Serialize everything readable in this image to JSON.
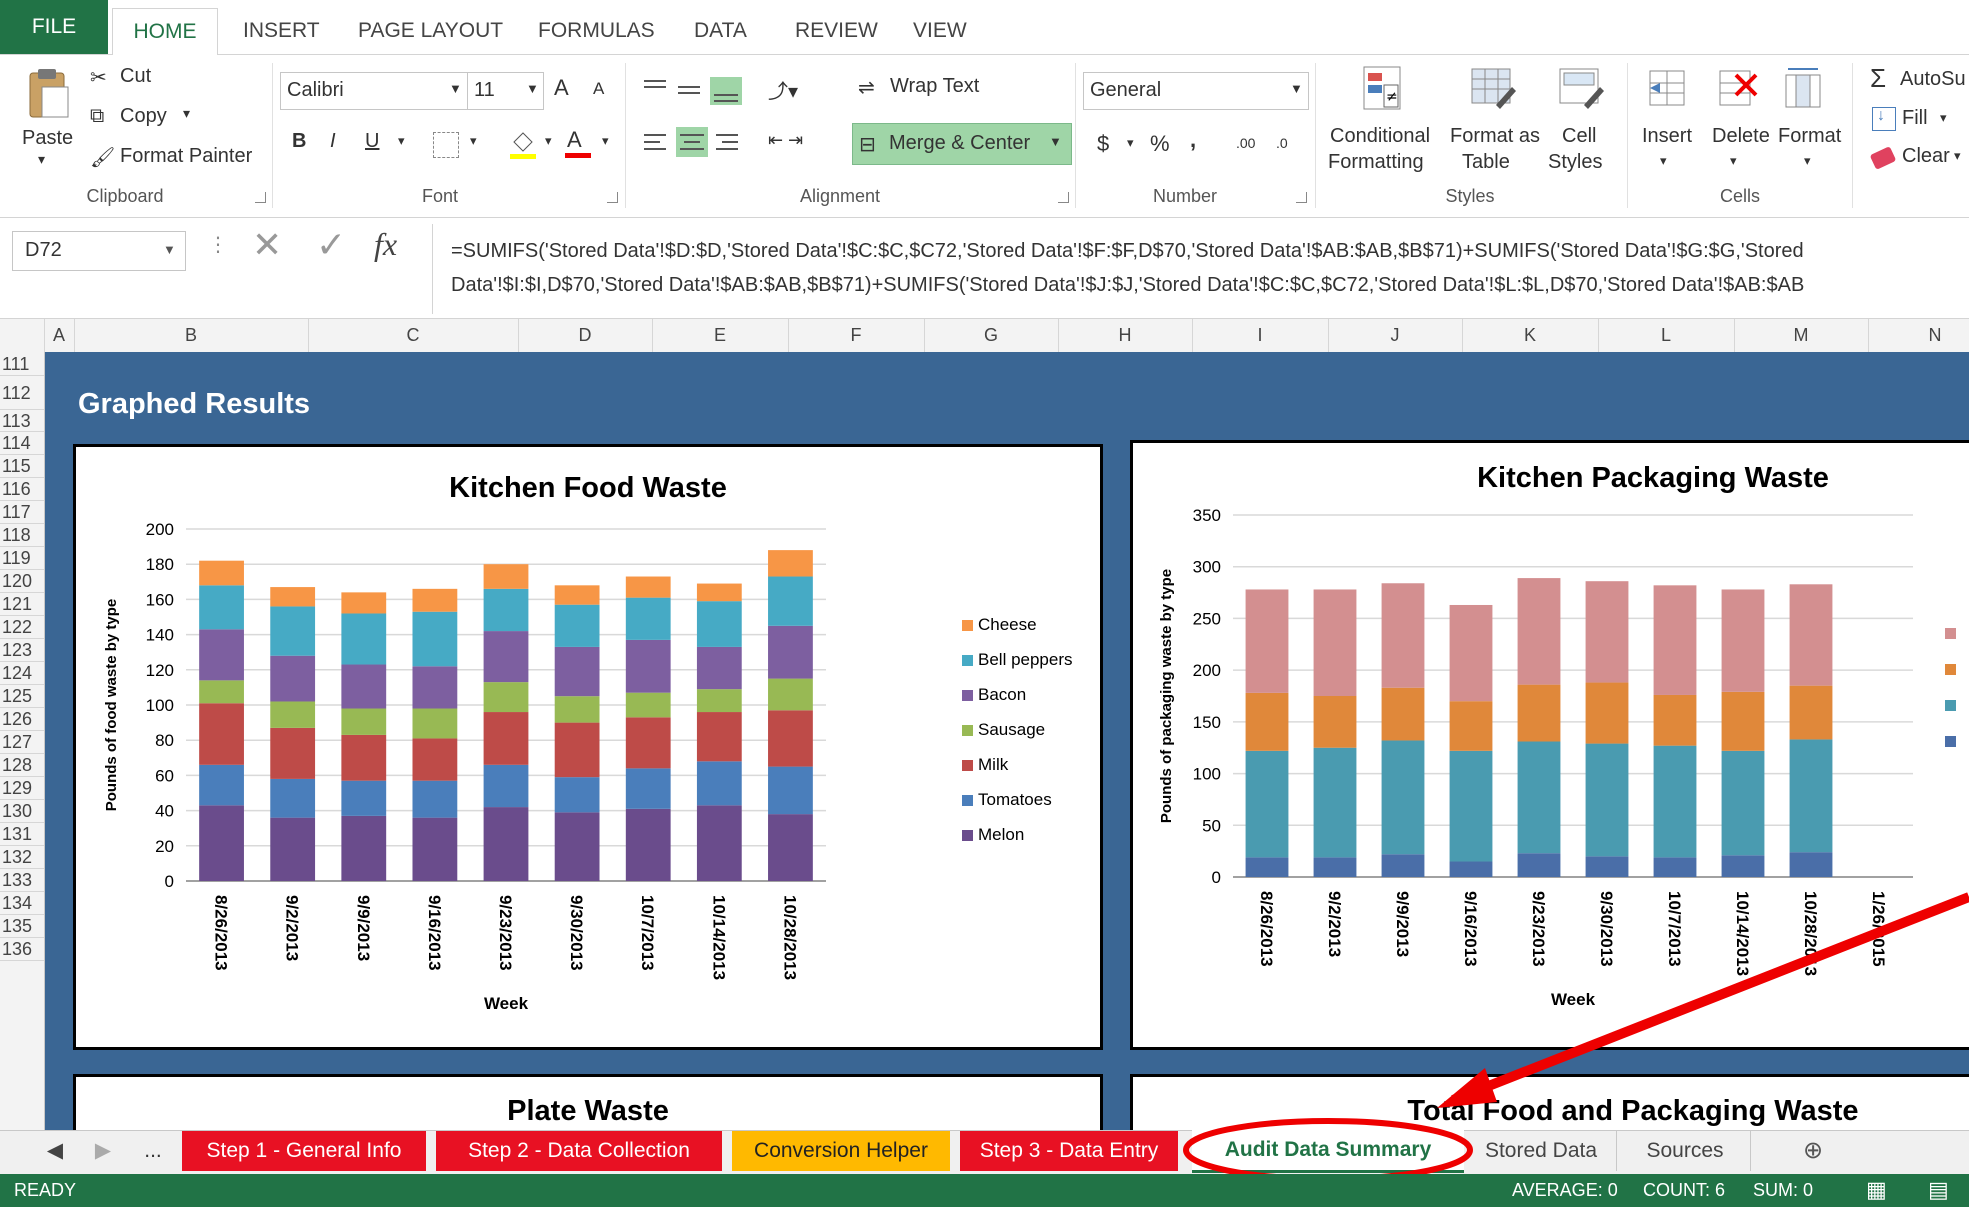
{
  "ribbon_tabs": [
    "FILE",
    "HOME",
    "INSERT",
    "PAGE LAYOUT",
    "FORMULAS",
    "DATA",
    "REVIEW",
    "VIEW"
  ],
  "clipboard": {
    "paste": "Paste",
    "cut": "Cut",
    "copy": "Copy",
    "format_painter": "Format Painter",
    "label": "Clipboard"
  },
  "font": {
    "name": "Calibri",
    "size": "11",
    "label": "Font",
    "bold": "B",
    "italic": "I",
    "underline": "U",
    "grow": "A",
    "shrink": "A",
    "color": "A"
  },
  "alignment": {
    "wrap": "Wrap Text",
    "merge": "Merge & Center",
    "label": "Alignment"
  },
  "number": {
    "format": "General",
    "currency": "$",
    "percent": "%",
    "comma": ",",
    "inc": ".00",
    "dec": ".0",
    "label": "Number"
  },
  "styles": {
    "conditional": "Conditional",
    "conditional2": "Formatting",
    "format_as": "Format as",
    "format_as2": "Table",
    "cell": "Cell",
    "cell2": "Styles",
    "label": "Styles"
  },
  "cells": {
    "insert": "Insert",
    "delete": "Delete",
    "format": "Format",
    "label": "Cells"
  },
  "editing": {
    "autosum": "AutoSu",
    "fill": "Fill",
    "clear": "Clear"
  },
  "formula_bar": {
    "name_box": "D72",
    "fx": "fx",
    "line1": "=SUMIFS('Stored Data'!$D:$D,'Stored Data'!$C:$C,$C72,'Stored Data'!$F:$F,D$70,'Stored Data'!$AB:$AB,$B$71)+SUMIFS('Stored Data'!$G:$G,'Stored",
    "line2": "Data'!$I:$I,D$70,'Stored Data'!$AB:$AB,$B$71)+SUMIFS('Stored Data'!$J:$J,'Stored Data'!$C:$C,$C72,'Stored Data'!$L:$L,D$70,'Stored Data'!$AB:$AB"
  },
  "columns": [
    "A",
    "B",
    "C",
    "D",
    "E",
    "F",
    "G",
    "H",
    "I",
    "J",
    "K",
    "L",
    "M",
    "N"
  ],
  "rows": [
    "111",
    "112",
    "113",
    "114",
    "115",
    "116",
    "117",
    "118",
    "119",
    "120",
    "121",
    "122",
    "123",
    "124",
    "125",
    "126",
    "127",
    "128",
    "129",
    "130",
    "131",
    "132",
    "133",
    "134",
    "135",
    "136"
  ],
  "section_title": "Graphed Results",
  "chart_titles": {
    "plate": "Plate Waste",
    "total": "Total Food and Packaging Waste"
  },
  "chart_data": [
    {
      "type": "bar",
      "stacked": true,
      "title": "Kitchen Food Waste",
      "xlabel": "Week",
      "ylabel": "Pounds of food waste by type",
      "ylim": [
        0,
        200
      ],
      "yticks": [
        0,
        20,
        40,
        60,
        80,
        100,
        120,
        140,
        160,
        180,
        200
      ],
      "categories": [
        "8/26/2013",
        "9/2/2013",
        "9/9/2013",
        "9/16/2013",
        "9/23/2013",
        "9/30/2013",
        "10/7/2013",
        "10/14/2013",
        "10/28/2013"
      ],
      "series": [
        {
          "name": "Melon",
          "color": "#6a4c8c",
          "values": [
            43,
            36,
            37,
            36,
            42,
            39,
            41,
            43,
            38
          ]
        },
        {
          "name": "Tomatoes",
          "color": "#4a7ebb",
          "values": [
            23,
            22,
            20,
            21,
            24,
            20,
            23,
            25,
            27
          ]
        },
        {
          "name": "Milk",
          "color": "#be4b48",
          "values": [
            35,
            29,
            26,
            24,
            30,
            31,
            29,
            28,
            32
          ]
        },
        {
          "name": "Sausage",
          "color": "#98b954",
          "values": [
            13,
            15,
            15,
            17,
            17,
            15,
            14,
            13,
            18
          ]
        },
        {
          "name": "Bacon",
          "color": "#7d5fa0",
          "values": [
            29,
            26,
            25,
            24,
            29,
            28,
            30,
            24,
            30
          ]
        },
        {
          "name": "Bell peppers",
          "color": "#46aac5",
          "values": [
            25,
            28,
            29,
            31,
            24,
            24,
            24,
            26,
            28
          ]
        },
        {
          "name": "Cheese",
          "color": "#f79646",
          "values": [
            14,
            11,
            12,
            13,
            14,
            11,
            12,
            10,
            15
          ]
        }
      ]
    },
    {
      "type": "bar",
      "stacked": true,
      "title": "Kitchen Packaging Waste",
      "xlabel": "Week",
      "ylabel": "Pounds of packaging waste by type",
      "ylim": [
        0,
        350
      ],
      "yticks": [
        0,
        50,
        100,
        150,
        200,
        250,
        300,
        350
      ],
      "categories": [
        "8/26/2013",
        "9/2/2013",
        "9/9/2013",
        "9/16/2013",
        "9/23/2013",
        "9/30/2013",
        "10/7/2013",
        "10/14/2013",
        "10/28/2013",
        "1/26/2015"
      ],
      "series": [
        {
          "name": "",
          "color": "#4a6ea8",
          "values": [
            19,
            19,
            22,
            15,
            23,
            20,
            19,
            21,
            24,
            0
          ]
        },
        {
          "name": "",
          "color": "#4a9bb0",
          "values": [
            103,
            106,
            110,
            107,
            108,
            109,
            108,
            101,
            109,
            0
          ]
        },
        {
          "name": "",
          "color": "#e0883a",
          "values": [
            56,
            50,
            51,
            48,
            55,
            59,
            49,
            57,
            52,
            0
          ]
        },
        {
          "name": "",
          "color": "#d38f90",
          "values": [
            100,
            103,
            101,
            93,
            103,
            98,
            106,
            99,
            98,
            0
          ]
        }
      ]
    }
  ],
  "sheet_tabs": [
    "...",
    "Step 1 - General Info",
    "Step 2 - Data Collection",
    "Conversion Helper",
    "Step 3 - Data Entry",
    "Audit Data Summary",
    "Stored Data",
    "Sources"
  ],
  "status": {
    "ready": "READY",
    "average": "AVERAGE: 0",
    "count": "COUNT: 6",
    "sum": "SUM: 0"
  }
}
